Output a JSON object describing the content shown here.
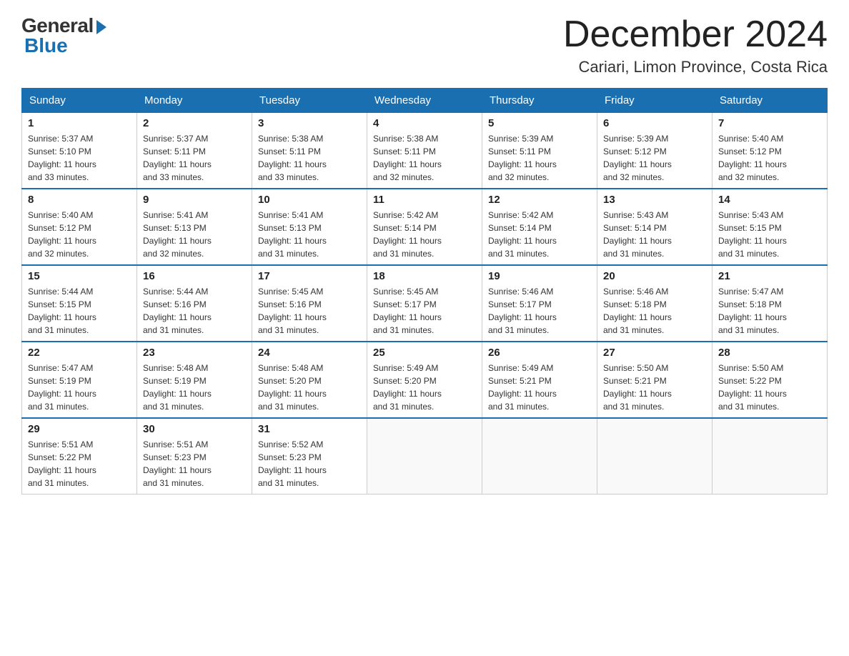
{
  "logo": {
    "general": "General",
    "blue": "Blue"
  },
  "header": {
    "month_year": "December 2024",
    "location": "Cariari, Limon Province, Costa Rica"
  },
  "weekdays": [
    "Sunday",
    "Monday",
    "Tuesday",
    "Wednesday",
    "Thursday",
    "Friday",
    "Saturday"
  ],
  "weeks": [
    [
      {
        "day": "1",
        "sunrise": "5:37 AM",
        "sunset": "5:10 PM",
        "daylight": "11 hours and 33 minutes."
      },
      {
        "day": "2",
        "sunrise": "5:37 AM",
        "sunset": "5:11 PM",
        "daylight": "11 hours and 33 minutes."
      },
      {
        "day": "3",
        "sunrise": "5:38 AM",
        "sunset": "5:11 PM",
        "daylight": "11 hours and 33 minutes."
      },
      {
        "day": "4",
        "sunrise": "5:38 AM",
        "sunset": "5:11 PM",
        "daylight": "11 hours and 32 minutes."
      },
      {
        "day": "5",
        "sunrise": "5:39 AM",
        "sunset": "5:11 PM",
        "daylight": "11 hours and 32 minutes."
      },
      {
        "day": "6",
        "sunrise": "5:39 AM",
        "sunset": "5:12 PM",
        "daylight": "11 hours and 32 minutes."
      },
      {
        "day": "7",
        "sunrise": "5:40 AM",
        "sunset": "5:12 PM",
        "daylight": "11 hours and 32 minutes."
      }
    ],
    [
      {
        "day": "8",
        "sunrise": "5:40 AM",
        "sunset": "5:12 PM",
        "daylight": "11 hours and 32 minutes."
      },
      {
        "day": "9",
        "sunrise": "5:41 AM",
        "sunset": "5:13 PM",
        "daylight": "11 hours and 32 minutes."
      },
      {
        "day": "10",
        "sunrise": "5:41 AM",
        "sunset": "5:13 PM",
        "daylight": "11 hours and 31 minutes."
      },
      {
        "day": "11",
        "sunrise": "5:42 AM",
        "sunset": "5:14 PM",
        "daylight": "11 hours and 31 minutes."
      },
      {
        "day": "12",
        "sunrise": "5:42 AM",
        "sunset": "5:14 PM",
        "daylight": "11 hours and 31 minutes."
      },
      {
        "day": "13",
        "sunrise": "5:43 AM",
        "sunset": "5:14 PM",
        "daylight": "11 hours and 31 minutes."
      },
      {
        "day": "14",
        "sunrise": "5:43 AM",
        "sunset": "5:15 PM",
        "daylight": "11 hours and 31 minutes."
      }
    ],
    [
      {
        "day": "15",
        "sunrise": "5:44 AM",
        "sunset": "5:15 PM",
        "daylight": "11 hours and 31 minutes."
      },
      {
        "day": "16",
        "sunrise": "5:44 AM",
        "sunset": "5:16 PM",
        "daylight": "11 hours and 31 minutes."
      },
      {
        "day": "17",
        "sunrise": "5:45 AM",
        "sunset": "5:16 PM",
        "daylight": "11 hours and 31 minutes."
      },
      {
        "day": "18",
        "sunrise": "5:45 AM",
        "sunset": "5:17 PM",
        "daylight": "11 hours and 31 minutes."
      },
      {
        "day": "19",
        "sunrise": "5:46 AM",
        "sunset": "5:17 PM",
        "daylight": "11 hours and 31 minutes."
      },
      {
        "day": "20",
        "sunrise": "5:46 AM",
        "sunset": "5:18 PM",
        "daylight": "11 hours and 31 minutes."
      },
      {
        "day": "21",
        "sunrise": "5:47 AM",
        "sunset": "5:18 PM",
        "daylight": "11 hours and 31 minutes."
      }
    ],
    [
      {
        "day": "22",
        "sunrise": "5:47 AM",
        "sunset": "5:19 PM",
        "daylight": "11 hours and 31 minutes."
      },
      {
        "day": "23",
        "sunrise": "5:48 AM",
        "sunset": "5:19 PM",
        "daylight": "11 hours and 31 minutes."
      },
      {
        "day": "24",
        "sunrise": "5:48 AM",
        "sunset": "5:20 PM",
        "daylight": "11 hours and 31 minutes."
      },
      {
        "day": "25",
        "sunrise": "5:49 AM",
        "sunset": "5:20 PM",
        "daylight": "11 hours and 31 minutes."
      },
      {
        "day": "26",
        "sunrise": "5:49 AM",
        "sunset": "5:21 PM",
        "daylight": "11 hours and 31 minutes."
      },
      {
        "day": "27",
        "sunrise": "5:50 AM",
        "sunset": "5:21 PM",
        "daylight": "11 hours and 31 minutes."
      },
      {
        "day": "28",
        "sunrise": "5:50 AM",
        "sunset": "5:22 PM",
        "daylight": "11 hours and 31 minutes."
      }
    ],
    [
      {
        "day": "29",
        "sunrise": "5:51 AM",
        "sunset": "5:22 PM",
        "daylight": "11 hours and 31 minutes."
      },
      {
        "day": "30",
        "sunrise": "5:51 AM",
        "sunset": "5:23 PM",
        "daylight": "11 hours and 31 minutes."
      },
      {
        "day": "31",
        "sunrise": "5:52 AM",
        "sunset": "5:23 PM",
        "daylight": "11 hours and 31 minutes."
      },
      null,
      null,
      null,
      null
    ]
  ],
  "labels": {
    "sunrise": "Sunrise:",
    "sunset": "Sunset:",
    "daylight": "Daylight:"
  }
}
